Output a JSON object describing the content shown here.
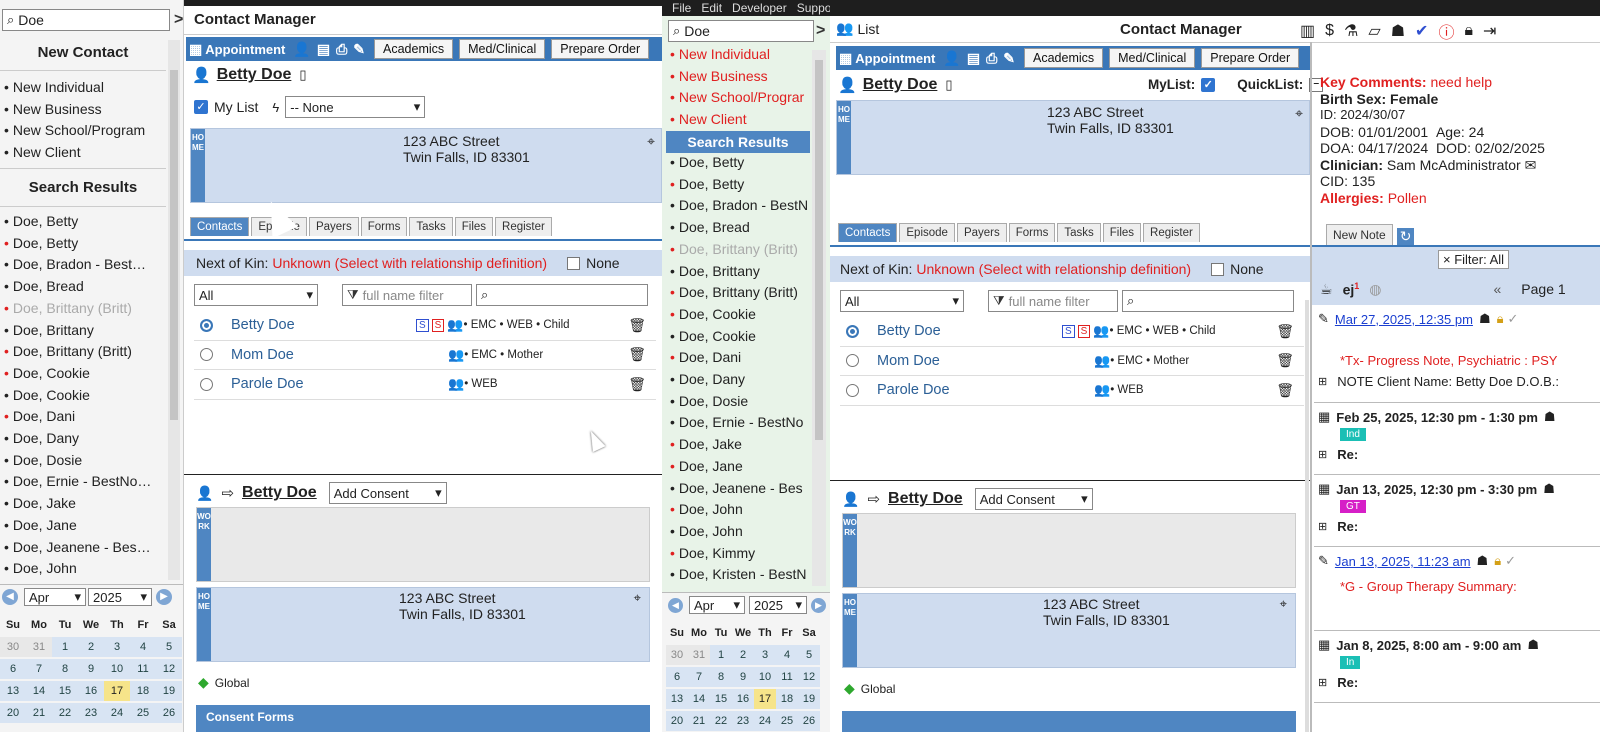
{
  "left": {
    "search": {
      "value": "Doe"
    },
    "new_contact_title": "New Contact",
    "new_items": [
      "New Individual",
      "New Business",
      "New School/Program",
      "New Client"
    ],
    "search_results_title": "Search Results",
    "results": [
      {
        "label": "Doe, Betty",
        "dot": "black"
      },
      {
        "label": "Doe, Betty",
        "dot": "red"
      },
      {
        "label": "Doe, Bradon - Best…",
        "dot": "black"
      },
      {
        "label": "Doe, Bread",
        "dot": "black"
      },
      {
        "label": "Doe, Brittany (Britt)",
        "dot": "red",
        "muted": true
      },
      {
        "label": "Doe, Brittany",
        "dot": "black"
      },
      {
        "label": "Doe, Brittany (Britt)",
        "dot": "red"
      },
      {
        "label": "Doe, Cookie",
        "dot": "red"
      },
      {
        "label": "Doe, Cookie",
        "dot": "black"
      },
      {
        "label": "Doe, Dani",
        "dot": "red"
      },
      {
        "label": "Doe, Dany",
        "dot": "black"
      },
      {
        "label": "Doe, Dosie",
        "dot": "black"
      },
      {
        "label": "Doe, Ernie - BestNo…",
        "dot": "black"
      },
      {
        "label": "Doe, Jake",
        "dot": "black"
      },
      {
        "label": "Doe, Jane",
        "dot": "black"
      },
      {
        "label": "Doe, Jeanene - Bes…",
        "dot": "black"
      },
      {
        "label": "Doe, John",
        "dot": "black"
      }
    ],
    "calendar": {
      "month": "Apr",
      "year": "2025",
      "weekdays": [
        "Su",
        "Mo",
        "Tu",
        "We",
        "Th",
        "Fr",
        "Sa"
      ],
      "weeks": [
        [
          "30",
          "31",
          "1",
          "2",
          "3",
          "4",
          "5"
        ],
        [
          "6",
          "7",
          "8",
          "9",
          "10",
          "11",
          "12"
        ],
        [
          "13",
          "14",
          "15",
          "16",
          "17",
          "18",
          "19"
        ],
        [
          "20",
          "21",
          "22",
          "23",
          "24",
          "25",
          "26"
        ]
      ]
    }
  },
  "main1": {
    "title": "Contact Manager",
    "toolbar": {
      "appointment": "Appointment",
      "academics": "Academics",
      "medclinical": "Med/Clinical",
      "prepare_order": "Prepare Order"
    },
    "contact_name": "Betty Doe",
    "mylist_label": "My List",
    "flag_select": "-- None",
    "address_line1": "123 ABC Street",
    "address_line2": "Twin Falls, ID 83301",
    "home_tag": "HOME",
    "work_tag": "WORK",
    "tabs": [
      "Contacts",
      "Episode",
      "Payers",
      "Forms",
      "Tasks",
      "Files",
      "Register"
    ],
    "nok_label": "Next of Kin:",
    "nok_value": "Unknown (Select with relationship definition)",
    "nok_none": "None",
    "filter_all": "All",
    "filter_placeholder": "full name filter",
    "contacts": [
      {
        "name": "Betty Doe",
        "tags": "• EMC • WEB • Child",
        "selected": true,
        "ss": true
      },
      {
        "name": "Mom Doe",
        "tags": "• EMC • Mother",
        "selected": false,
        "ss": false
      },
      {
        "name": "Parole Doe",
        "tags": "• WEB",
        "selected": false,
        "ss": false
      }
    ],
    "consent_name": "Betty Doe",
    "add_consent": "Add Consent",
    "global_label": "Global",
    "consent_forms": "Consent Forms"
  },
  "mid": {
    "menu": [
      "File",
      "Edit",
      "Developer",
      "Support"
    ],
    "search": {
      "value": "Doe"
    },
    "new_items": [
      "New Individual",
      "New Business",
      "New School/Prograr",
      "New Client"
    ],
    "search_results_title": "Search Results",
    "results": [
      {
        "label": "Doe, Betty",
        "dot": "black"
      },
      {
        "label": "Doe, Betty",
        "dot": "red"
      },
      {
        "label": "Doe, Bradon - BestN",
        "dot": "black"
      },
      {
        "label": "Doe, Bread",
        "dot": "black"
      },
      {
        "label": "Doe, Brittany (Britt)",
        "dot": "red",
        "muted": true
      },
      {
        "label": "Doe, Brittany",
        "dot": "black"
      },
      {
        "label": "Doe, Brittany (Britt)",
        "dot": "red"
      },
      {
        "label": "Doe, Cookie",
        "dot": "red"
      },
      {
        "label": "Doe, Cookie",
        "dot": "black"
      },
      {
        "label": "Doe, Dani",
        "dot": "red"
      },
      {
        "label": "Doe, Dany",
        "dot": "black"
      },
      {
        "label": "Doe, Dosie",
        "dot": "black"
      },
      {
        "label": "Doe, Ernie - BestNo",
        "dot": "black"
      },
      {
        "label": "Doe, Jake",
        "dot": "red"
      },
      {
        "label": "Doe, Jane",
        "dot": "red"
      },
      {
        "label": "Doe, Jeanene - Bes",
        "dot": "black"
      },
      {
        "label": "Doe, John",
        "dot": "red"
      },
      {
        "label": "Doe, John",
        "dot": "black"
      },
      {
        "label": "Doe, Kimmy",
        "dot": "red"
      },
      {
        "label": "Doe, Kristen - BestN",
        "dot": "black"
      }
    ],
    "calendar": {
      "month": "Apr",
      "year": "2025",
      "weeks": [
        [
          "30",
          "31",
          "1",
          "2",
          "3",
          "4",
          "5"
        ],
        [
          "6",
          "7",
          "8",
          "9",
          "10",
          "11",
          "12"
        ],
        [
          "13",
          "14",
          "15",
          "16",
          "17",
          "18",
          "19"
        ],
        [
          "20",
          "21",
          "22",
          "23",
          "24",
          "25",
          "26"
        ]
      ]
    }
  },
  "main2": {
    "list_label": "List",
    "title": "Contact Manager",
    "contact_name": "Betty Doe",
    "mylist_label": "MyList:",
    "quicklist_label": "QuickList:",
    "address_line1": "123 ABC Street",
    "address_line2": "Twin Falls, ID 83301",
    "global_label": "Global",
    "key_comments_label": "Key Comments:",
    "key_comments_value": "need help",
    "birth_sex": "Birth Sex: Female",
    "id": "ID: 2024/30/07",
    "dob": "DOB: 01/01/2001",
    "age": "Age: 24",
    "doa": "DOA: 04/17/2024",
    "dod": "DOD: 02/02/2025",
    "clinician_label": "Clinician:",
    "clinician_value": "Sam McAdministrator",
    "cid": "CID: 135",
    "allergies_label": "Allergies:",
    "allergies_value": "Pollen",
    "new_note": "New Note",
    "filter": "Filter: All",
    "page": "Page 1",
    "notes": [
      {
        "date": "Mar 27, 2025, 12:35 pm",
        "link": true,
        "title": "*Tx- Progress Note, Psychiatric : PSY",
        "body": "NOTE Client Name: Betty Doe  D.O.B.:"
      },
      {
        "date": "Feb 25, 2025, 12:30 pm - 1:30 pm",
        "link": false,
        "badge": "Ind",
        "badge_color": "#1bbfb5",
        "body": "Re:"
      },
      {
        "date": "Jan 13, 2025, 12:30 pm - 3:30 pm",
        "link": false,
        "badge": "GT",
        "badge_color": "#d61fc7",
        "body": "Re:"
      },
      {
        "date": "Jan 13, 2025, 11:23 am",
        "link": true,
        "title": "*G - Group Therapy Summary:"
      },
      {
        "date": "Jan 8, 2025, 8:00 am - 9:00 am",
        "link": false,
        "badge": "In",
        "badge_color": "#1bbfb5",
        "body": "Re:"
      }
    ]
  },
  "colors": {
    "accent": "#3a77b8",
    "home_bg": "#cfdcef",
    "red": "#e02020",
    "link": "#1b3fd0"
  }
}
